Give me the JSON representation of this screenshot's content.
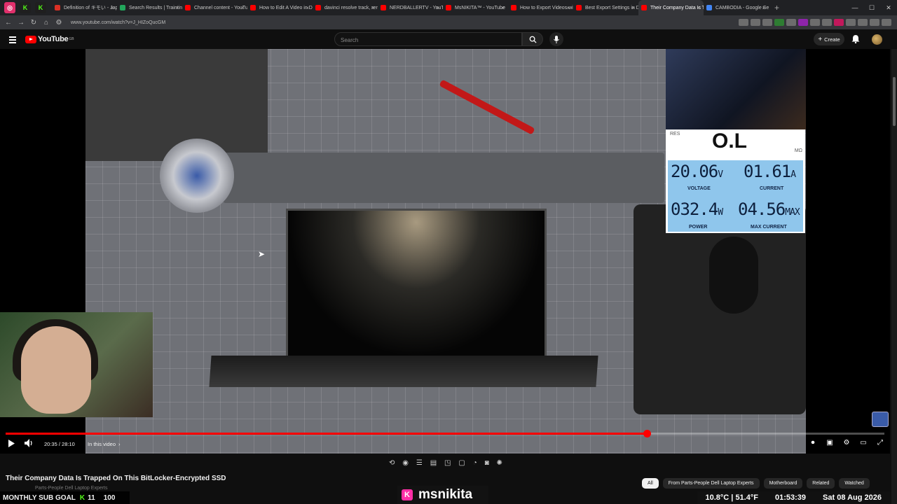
{
  "browser": {
    "tabs": [
      {
        "title": "Definition of キモい - Jap",
        "color": "#d93025"
      },
      {
        "title": "Search Results | Traintine",
        "color": "#22a65b"
      },
      {
        "title": "Channel content - YouTub",
        "color": "#ff0000"
      },
      {
        "title": "How to Edit A Video in D",
        "color": "#ff0000"
      },
      {
        "title": "davinci resolve track, rem",
        "color": "#ff0000"
      },
      {
        "title": "NERDBALLERTV - YouTub",
        "color": "#ff0000"
      },
      {
        "title": "MsNIKITA™ - YouTube",
        "color": "#ff0000"
      },
      {
        "title": "How to Export Videos wit",
        "color": "#ff0000"
      },
      {
        "title": "Best Export Settings in D",
        "color": "#ff0000"
      },
      {
        "title": "Their Company Data Is T",
        "color": "#ff0000"
      },
      {
        "title": "CAMBODIA - Google Sea",
        "color": "#4285f4"
      }
    ],
    "url": "www.youtube.com/watch?v=J_HIZoQucGM"
  },
  "youtube": {
    "logo_text": "YouTube",
    "logo_region": "GB",
    "search_placeholder": "Search",
    "create_label": "Create"
  },
  "meter": {
    "top_left_label": "RES",
    "top_value": "O.L",
    "unit_right": "MΩ",
    "voltage_value": "20.06",
    "voltage_unit": "V",
    "voltage_label": "VOLTAGE",
    "current_value": "01.61",
    "current_unit": "A",
    "current_label": "CURRENT",
    "power_value": "032.4",
    "power_unit": "W",
    "power_label": "POWER",
    "max_current_value": "04.56",
    "max_current_unit": "MAX",
    "max_current_label": "MAX CURRENT"
  },
  "player": {
    "time": "20:35 / 28:10",
    "chapter": "In this video",
    "progress_fraction": 0.73
  },
  "video": {
    "title": "Their Company Data Is Trapped On This BitLocker-Encrypted SSD",
    "channel": "Parts-People Dell Laptop Experts"
  },
  "chips": [
    {
      "label": "All",
      "active": true
    },
    {
      "label": "From Parts-People Dell Laptop Experts",
      "active": false
    },
    {
      "label": "Motherboard",
      "active": false
    },
    {
      "label": "Related",
      "active": false
    },
    {
      "label": "Watched",
      "active": false
    }
  ],
  "overlay": {
    "sub_goal_label": "MONTHLY SUB GOAL",
    "sub_goal_current": "11",
    "sub_goal_target": "100",
    "kick_name": "msnikita",
    "weather": "10.8°C | 51.4°F",
    "clock": "01:53:39",
    "date": "Sat 08 Aug 2026"
  }
}
